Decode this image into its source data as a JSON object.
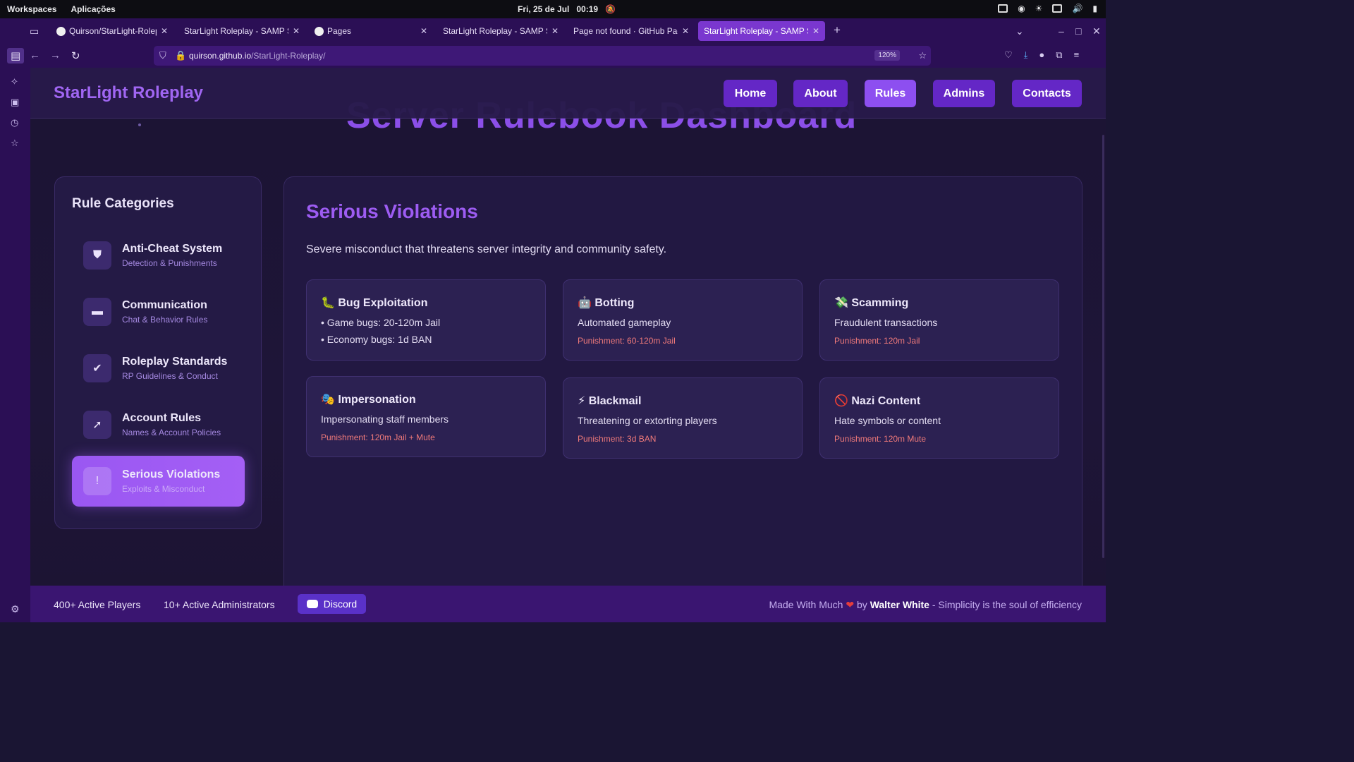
{
  "system_bar": {
    "workspaces": "Workspaces",
    "apps": "Aplicações",
    "date": "Fri, 25 de Jul",
    "time": "00:19"
  },
  "tabs": [
    {
      "label": "Quirson/StarLight-Roleplay",
      "icon": "github-icon"
    },
    {
      "label": "StarLight Roleplay - SAMP Server",
      "icon": ""
    },
    {
      "label": "Pages",
      "icon": "github-icon"
    },
    {
      "label": "StarLight Roleplay - SAMP Server",
      "icon": ""
    },
    {
      "label": "Page not found · GitHub Pages",
      "icon": ""
    },
    {
      "label": "StarLight Roleplay - SAMP Server",
      "icon": "",
      "active": true
    }
  ],
  "url": {
    "host": "quirson.github.io",
    "path": "/StarLight-Roleplay/",
    "zoom": "120%"
  },
  "site": {
    "brand": "StarLight Roleplay",
    "hero_title": "Server Rulebook Dashboard",
    "menu": [
      "Home",
      "About",
      "Rules",
      "Admins",
      "Contacts"
    ],
    "active_menu": "Rules"
  },
  "categories": {
    "heading": "Rule Categories",
    "items": [
      {
        "title": "Anti-Cheat System",
        "subtitle": "Detection & Punishments",
        "icon": "shield-icon"
      },
      {
        "title": "Communication",
        "subtitle": "Chat & Behavior Rules",
        "icon": "chat-icon"
      },
      {
        "title": "Roleplay Standards",
        "subtitle": "RP Guidelines & Conduct",
        "icon": "check-circle-icon"
      },
      {
        "title": "Account Rules",
        "subtitle": "Names & Account Policies",
        "icon": "user-key-icon"
      },
      {
        "title": "Serious Violations",
        "subtitle": "Exploits & Misconduct",
        "icon": "alert-shield-icon",
        "active": true
      }
    ]
  },
  "main": {
    "title": "Serious Violations",
    "description": "Severe misconduct that threatens server integrity and community safety.",
    "cards": [
      {
        "emoji": "🐛",
        "title": "Bug Exploitation",
        "lines": [
          "• Game bugs: 20-120m Jail",
          "• Economy bugs: 1d BAN"
        ],
        "punishment": ""
      },
      {
        "emoji": "🤖",
        "title": "Botting",
        "lines": [
          "Automated gameplay"
        ],
        "punishment": "Punishment: 60-120m Jail"
      },
      {
        "emoji": "💸",
        "title": "Scamming",
        "lines": [
          "Fraudulent transactions"
        ],
        "punishment": "Punishment: 120m Jail"
      },
      {
        "emoji": "🎭",
        "title": "Impersonation",
        "lines": [
          "Impersonating staff members"
        ],
        "punishment": "Punishment: 120m Jail + Mute"
      },
      {
        "emoji": "⚡",
        "title": "Blackmail",
        "lines": [
          "Threatening or extorting players"
        ],
        "punishment": "Punishment: 3d BAN"
      },
      {
        "emoji": "🚫",
        "title": "Nazi Content",
        "lines": [
          "Hate symbols or content"
        ],
        "punishment": "Punishment: 120m Mute"
      }
    ]
  },
  "footer": {
    "players": "400+ Active Players",
    "admins": "10+ Active Administrators",
    "discord": "Discord",
    "credit_prefix": "Made With Much",
    "credit_by": "by",
    "author": "Walter White",
    "tagline": "- Simplicity is the soul of efficiency"
  }
}
